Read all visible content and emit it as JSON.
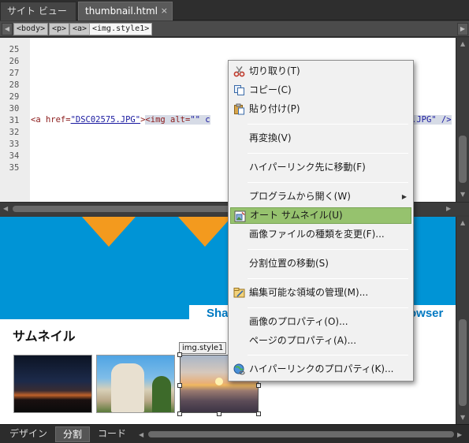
{
  "tabs": {
    "site_view": "サイト ビュー",
    "file": "thumbnail.html",
    "file_close": "×"
  },
  "tag_selector": {
    "tags": [
      "<body>",
      "<p>",
      "<a>",
      "<img.style1>"
    ],
    "selected": "<img.style1>"
  },
  "code_view": {
    "line_numbers": [
      "25",
      "26",
      "27",
      "28",
      "29",
      "30",
      "31",
      "32",
      "33",
      "34",
      "35"
    ],
    "line31": {
      "open_a": "<a ",
      "href_attr": "href=",
      "href_val": "\"DSC02575.JPG\"",
      "close_gt": ">",
      "img_tag": "<img ",
      "alt_attr": "alt=",
      "alt_val": "\"\"",
      "c": " c",
      "tail": ".JPG\" />"
    }
  },
  "design_view": {
    "share_text": "Shar",
    "browser_text": "owser",
    "heading": "サムネイル",
    "selected_image_label": "img.style1"
  },
  "view_tabs": {
    "design": "デザイン",
    "split": "分割",
    "code": "コード",
    "active": "分割"
  },
  "context_menu": {
    "items": [
      {
        "label": "切り取り(T)",
        "icon": "scissors-icon"
      },
      {
        "label": "コピー(C)",
        "icon": "copy-icon"
      },
      {
        "label": "貼り付け(P)",
        "icon": "paste-icon"
      },
      {
        "label": "再変換(V)"
      },
      {
        "label": "ハイパーリンク先に移動(F)"
      },
      {
        "label": "プログラムから開く(W)",
        "submenu": true
      },
      {
        "label": "オート サムネイル(U)",
        "icon": "auto-thumbnail-icon",
        "highlighted": true
      },
      {
        "label": "画像ファイルの種類を変更(F)..."
      },
      {
        "label": "分割位置の移動(S)"
      },
      {
        "label": "編集可能な領域の管理(M)...",
        "icon": "editable-region-icon"
      },
      {
        "label": "画像のプロパティ(O)..."
      },
      {
        "label": "ページのプロパティ(A)..."
      },
      {
        "label": "ハイパーリンクのプロパティ(K)...",
        "icon": "hyperlink-icon"
      }
    ],
    "highlight_color": "#96c26e"
  },
  "colors": {
    "header_blue": "#0094d6",
    "accent_orange": "#f39a1e",
    "link_blue": "#0079c2"
  }
}
